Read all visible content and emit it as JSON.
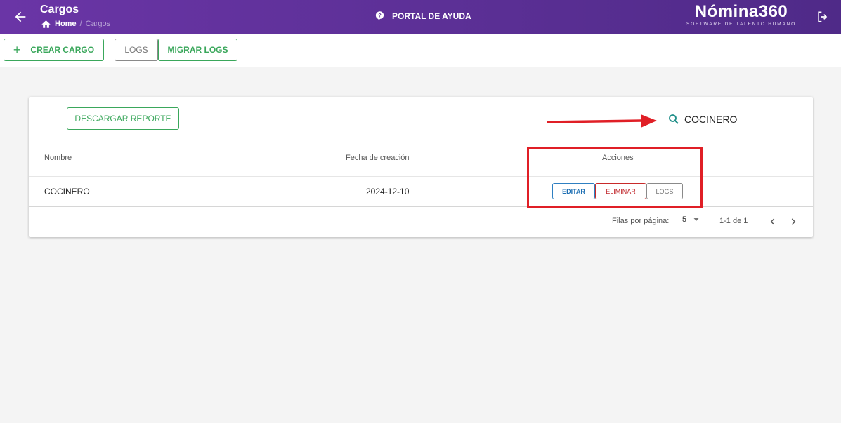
{
  "header": {
    "title": "Cargos",
    "breadcrumb_home": "Home",
    "breadcrumb_sep": "/",
    "breadcrumb_current": "Cargos",
    "portal_label": "PORTAL DE AYUDA",
    "brand_name": "Nómina360",
    "brand_tagline": "SOFTWARE DE TALENTO HUMANO"
  },
  "toolbar": {
    "create_label": "CREAR CARGO",
    "logs_label": "LOGS",
    "migrate_label": "MIGRAR LOGS"
  },
  "card": {
    "report_label": "DESCARGAR REPORTE",
    "search_value": "COCINERO",
    "columns": [
      "Nombre",
      "Fecha de creación",
      "Acciones"
    ],
    "rows": [
      {
        "name": "COCINERO",
        "date": "2024-12-10"
      }
    ],
    "actions": {
      "edit": "EDITAR",
      "delete": "ELIMINAR",
      "logs": "LOGS"
    }
  },
  "pagination": {
    "rows_label": "Filas por página:",
    "rows_value": "5",
    "range": "1-1 de 1"
  },
  "colors": {
    "header": "#5a2f94",
    "green": "#3aa75b",
    "blue": "#1d6fb3",
    "red": "#c0282d",
    "annotation": "#e01f26"
  }
}
